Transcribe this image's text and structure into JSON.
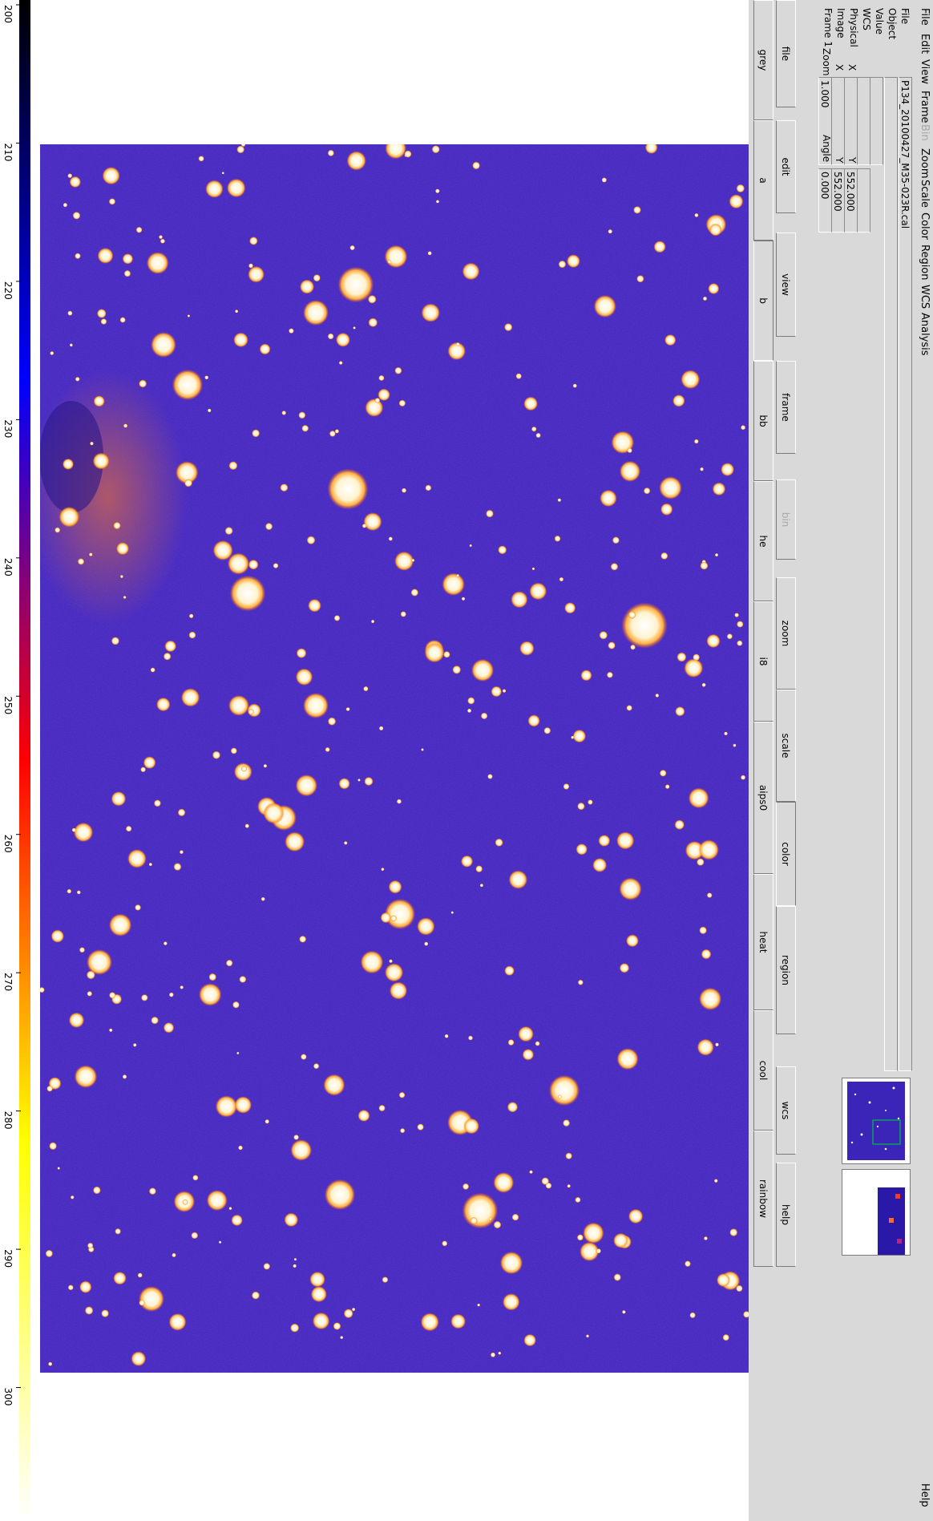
{
  "menubar": {
    "items": [
      {
        "label": "File"
      },
      {
        "label": "Edit"
      },
      {
        "label": "View"
      },
      {
        "label": "Frame"
      },
      {
        "label": "Bin",
        "disabled": true
      },
      {
        "label": "Zoom"
      },
      {
        "label": "Scale"
      },
      {
        "label": "Color"
      },
      {
        "label": "Region"
      },
      {
        "label": "WCS"
      },
      {
        "label": "Analysis"
      }
    ],
    "help": "Help"
  },
  "info": {
    "file_label": "File",
    "file_value": "P134_20100427_M35-023R.cal",
    "object_label": "Object",
    "value_label": "Value",
    "wcs_label": "WCS",
    "physical_label": "Physical",
    "image_label": "Image",
    "frame_label": "Frame 1",
    "x_label": "X",
    "y_label": "Y",
    "zoom_label": "Zoom",
    "zoom_value": "1.000",
    "angle_label": "Angle",
    "angle_value": "0.000",
    "physical_y_value": "552.000",
    "image_y_value": "552.000"
  },
  "buttonbar": {
    "main": [
      {
        "label": "file"
      },
      {
        "label": "edit"
      },
      {
        "label": "view"
      },
      {
        "label": "frame"
      },
      {
        "label": "bin",
        "disabled": true
      },
      {
        "label": "zoom"
      },
      {
        "label": "scale"
      },
      {
        "label": "color",
        "active": true
      },
      {
        "label": "region"
      },
      {
        "label": "wcs"
      },
      {
        "label": "help"
      }
    ],
    "sub": [
      {
        "label": "grey"
      },
      {
        "label": "a"
      },
      {
        "label": "b",
        "active": true
      },
      {
        "label": "bb"
      },
      {
        "label": "he"
      },
      {
        "label": "i8"
      },
      {
        "label": "aips0"
      },
      {
        "label": "heat"
      },
      {
        "label": "cool"
      },
      {
        "label": "rainbow"
      }
    ]
  },
  "colorbar": {
    "colormap": "b",
    "ticks": [
      "200",
      "210",
      "220",
      "230",
      "240",
      "250",
      "260",
      "270",
      "280",
      "290",
      "300"
    ],
    "colors": [
      "#000000",
      "#0000ff",
      "#ff0000",
      "#ffff00",
      "#ffffff"
    ]
  },
  "image": {
    "background_color": "#3a25b8",
    "star_color": "#fff6e0",
    "halo_color": "#ff8a1c"
  }
}
